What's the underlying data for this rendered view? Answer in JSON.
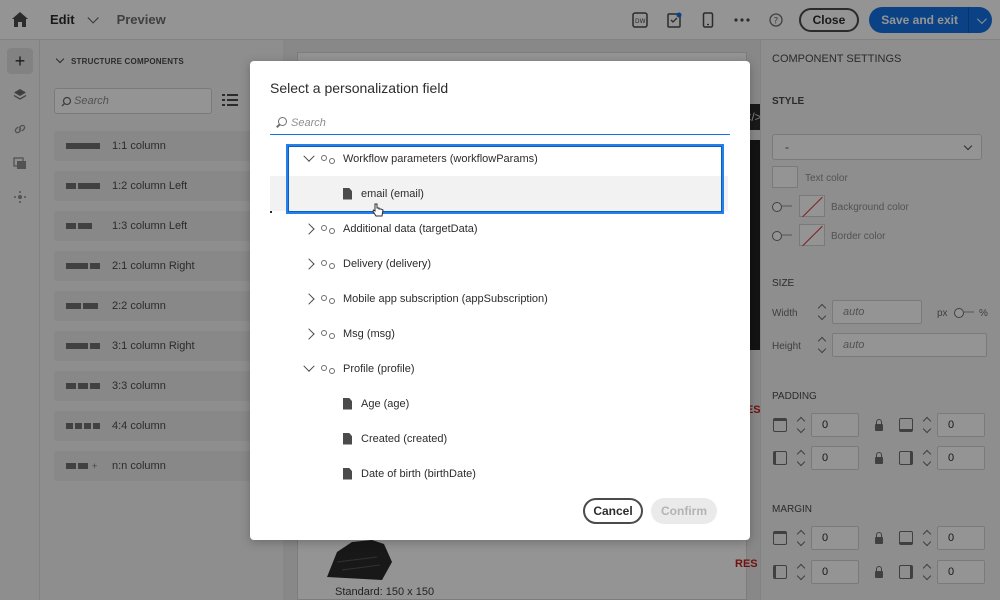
{
  "topbar": {
    "home_icon": "home-icon",
    "edit_tab": "Edit",
    "preview_tab": "Preview",
    "close_label": "Close",
    "save_label": "Save and exit",
    "accent": "#1473e6"
  },
  "left_panel": {
    "title": "STRUCTURE COMPONENTS",
    "search_placeholder": "Search",
    "components": [
      {
        "label": "1:1 column"
      },
      {
        "label": "1:2 column Left"
      },
      {
        "label": "1:3 column Left"
      },
      {
        "label": "2:1 column Right"
      },
      {
        "label": "2:2 column"
      },
      {
        "label": "3:1 column Right"
      },
      {
        "label": "3:3 column"
      },
      {
        "label": "4:4 column"
      },
      {
        "label": "n:n column"
      }
    ]
  },
  "canvas": {
    "res_label": "RES",
    "standard_caption": "Standard: 150 x 150"
  },
  "right_panel": {
    "title": "COMPONENT SETTINGS",
    "style_label": "STYLE",
    "style_select_value": "-",
    "text_color_label": "Text color",
    "background_color_label": "Background color",
    "border_color_label": "Border color",
    "size_label": "SIZE",
    "width_label": "Width",
    "width_placeholder": "auto",
    "px_label": "px",
    "percent_label": "%",
    "height_label": "Height",
    "height_placeholder": "auto",
    "padding_label": "PADDING",
    "margin_label": "MARGIN",
    "padding_values": [
      "0",
      "0",
      "0",
      "0"
    ],
    "margin_values": [
      "0",
      "0",
      "0",
      "0"
    ]
  },
  "modal": {
    "title": "Select a personalization field",
    "search_placeholder": "Search",
    "tree": [
      {
        "label": "Workflow parameters (workflowParams)",
        "type": "link",
        "expanded": true
      },
      {
        "label": "email (email)",
        "type": "field"
      },
      {
        "label": "Additional data (targetData)",
        "type": "link",
        "expanded": false
      },
      {
        "label": "Delivery (delivery)",
        "type": "link",
        "expanded": false
      },
      {
        "label": "Mobile app subscription (appSubscription)",
        "type": "link",
        "expanded": false
      },
      {
        "label": "Msg (msg)",
        "type": "link",
        "expanded": false
      },
      {
        "label": "Profile (profile)",
        "type": "link",
        "expanded": true
      },
      {
        "label": "Age (age)",
        "type": "field"
      },
      {
        "label": "Created (created)",
        "type": "field"
      },
      {
        "label": "Date of birth (birthDate)",
        "type": "field"
      }
    ],
    "cancel_label": "Cancel",
    "confirm_label": "Confirm"
  }
}
